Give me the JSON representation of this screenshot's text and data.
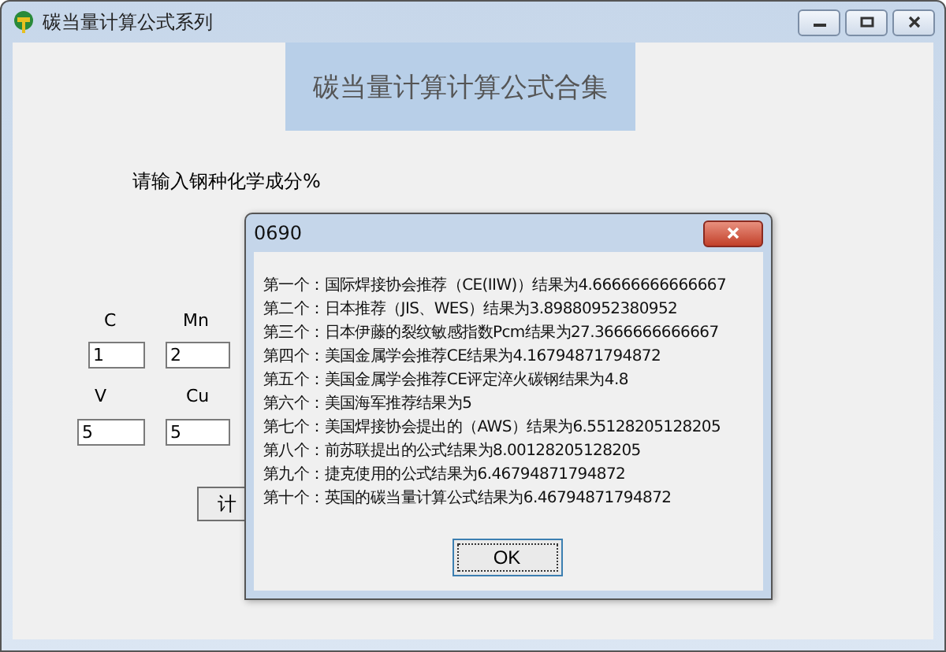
{
  "window": {
    "title": "碳当量计算公式系列"
  },
  "banner": {
    "title": "碳当量计算计算公式合集"
  },
  "prompt": "请输入钢种化学成分%",
  "elements": [
    {
      "label": "C",
      "value": "1"
    },
    {
      "label": "Mn",
      "value": "2"
    },
    {
      "label": "V",
      "value": "5"
    },
    {
      "label": "Cu",
      "value": "5"
    }
  ],
  "calculate_button": {
    "label": "计"
  },
  "dialog": {
    "title": "0690",
    "lines": [
      "第一个：国际焊接协会推荐（CE(IIW)）结果为4.66666666666667",
      "第二个：日本推荐（JIS、WES）结果为3.89880952380952",
      "第三个：日本伊藤的裂纹敏感指数Pcm结果为27.3666666666667",
      "第四个：美国金属学会推荐CE结果为4.16794871794872",
      "第五个：美国金属学会推荐CE评定淬火碳钢结果为4.8",
      "第六个：美国海军推荐结果为5",
      "第七个：美国焊接协会提出的（AWS）结果为6.55128205128205",
      "第八个：前苏联提出的公式结果为8.00128205128205",
      "第九个：捷克使用的公式结果为6.46794871794872",
      "第十个：英国的碳当量计算公式结果为6.46794871794872"
    ],
    "ok_label": "OK"
  }
}
